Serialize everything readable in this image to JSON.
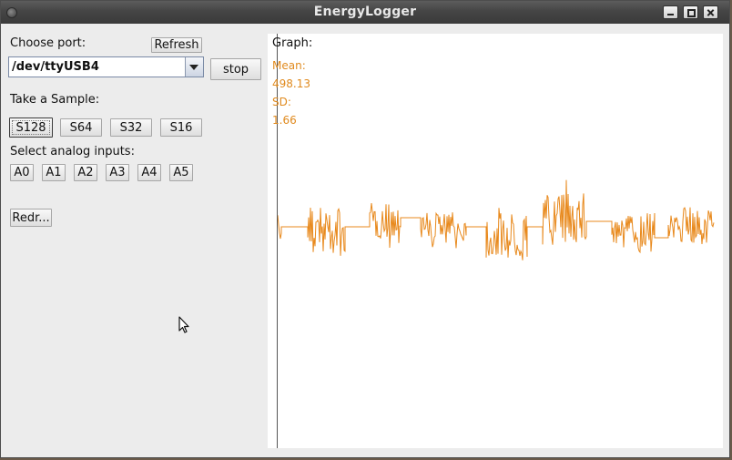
{
  "window": {
    "title": "EnergyLogger"
  },
  "port": {
    "label": "Choose port:",
    "refresh_label": "Refresh",
    "selected": "/dev/ttyUSB4",
    "stop_label": "stop"
  },
  "sample": {
    "label": "Take a Sample:",
    "buttons": [
      "S128",
      "S64",
      "S32",
      "S16"
    ]
  },
  "analog": {
    "label": "Select analog inputs:",
    "buttons": [
      "A0",
      "A1",
      "A2",
      "A3",
      "A4",
      "A5"
    ]
  },
  "redraw_label": "Redr...",
  "graph": {
    "label": "Graph:",
    "mean_label": "Mean:",
    "mean_value": "498.13",
    "sd_label": "SD:",
    "sd_value": "1.66",
    "line_color": "#e8891c"
  },
  "icons": [
    "window-menu-icon",
    "minimize-icon",
    "maximize-icon",
    "close-icon",
    "chevron-down-icon",
    "mouse-cursor-icon"
  ]
}
